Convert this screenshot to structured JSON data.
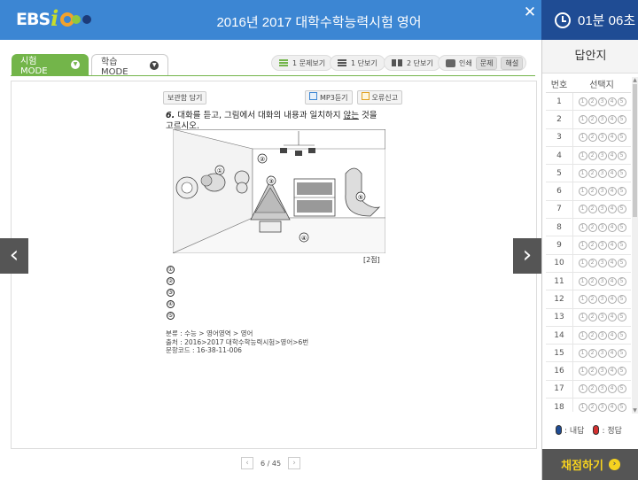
{
  "header": {
    "logo_text": "EBS",
    "logo_i": "i",
    "title": "2016년 2017 대학수학능력시험 영어",
    "close_glyph": "✕"
  },
  "timer": {
    "text": "01분 06초"
  },
  "tabs": [
    {
      "label": "시험 MODE",
      "active": true
    },
    {
      "label": "학습 MODE",
      "active": false
    }
  ],
  "toolbar": {
    "one_question": "1 문제보기",
    "one_column": "1 단보기",
    "two_column": "2 단보기",
    "print": "인쇄",
    "print_question": "문제",
    "print_answer": "해설"
  },
  "question_tools": {
    "close_note": "보관함 담기",
    "mp3": "MP3듣기",
    "report": "오류신고"
  },
  "question": {
    "number": "6.",
    "text_before": " 대화를 듣고, 그림에서 대화의 내용과 일치하지 ",
    "text_underline": "않는",
    "text_after": " 것을",
    "text_line2": "고르시오.",
    "points": "[2점]",
    "choices": [
      "①",
      "②",
      "③",
      "④",
      "⑤"
    ],
    "scene_labels": [
      "①",
      "②",
      "③",
      "④",
      "⑤"
    ]
  },
  "meta": {
    "line1": "분류 :  수능 > 영어영역 > 영어",
    "line2": "출처 :  2016>2017 대학수학능력시험>영어>6번",
    "line3": "문항코드 : 16-38-11-006"
  },
  "pager": {
    "text": "6 / 45",
    "prev": "‹",
    "next": "›"
  },
  "nav": {
    "prev": "‹",
    "next": "›"
  },
  "answer_sheet": {
    "title": "답안지",
    "col_number": "번호",
    "col_choice": "선택지",
    "rows": [
      "1",
      "2",
      "3",
      "4",
      "5",
      "6",
      "7",
      "8",
      "9",
      "10",
      "11",
      "12",
      "13",
      "14",
      "15",
      "16",
      "17",
      "18"
    ],
    "options": [
      "1",
      "2",
      "3",
      "4",
      "5"
    ],
    "legend_mine": ": 내답",
    "legend_correct": ": 정답",
    "grade_button": "채점하기",
    "grade_arrow": "›"
  },
  "colors": {
    "header_blue": "#3c86d3",
    "timer_navy": "#1f4c94",
    "tab_green": "#73b54a",
    "grade_yellow": "#f6d21f"
  }
}
